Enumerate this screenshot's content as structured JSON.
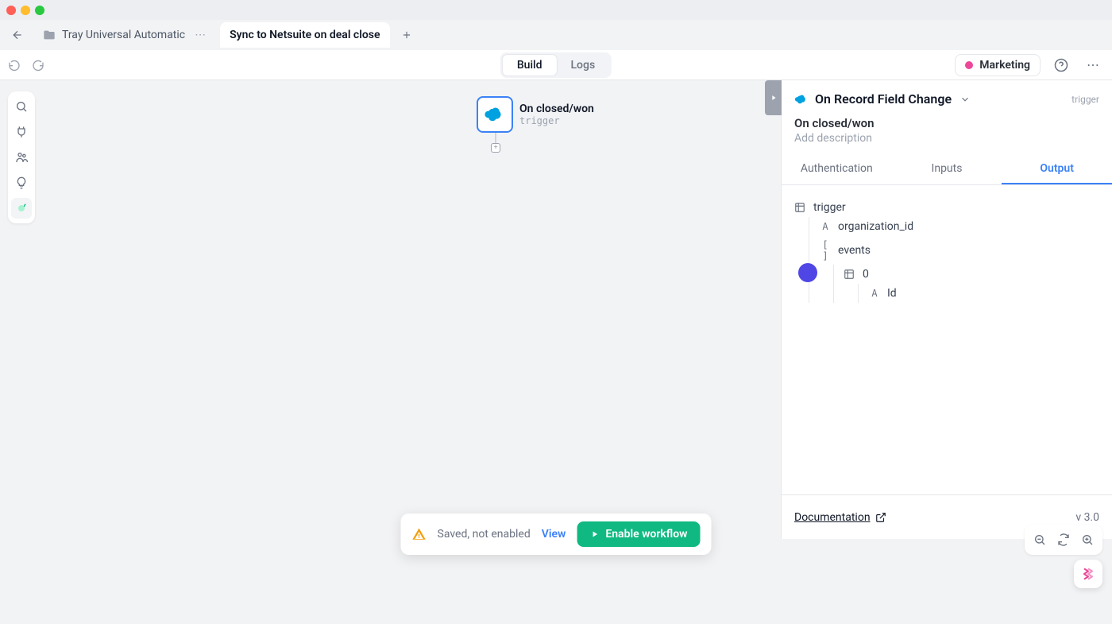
{
  "tabs": {
    "project": "Tray Universal Automatic",
    "active": "Sync to Netsuite on deal close"
  },
  "toolbar": {
    "segments": {
      "build": "Build",
      "logs": "Logs"
    },
    "marketing": "Marketing"
  },
  "canvas": {
    "node": {
      "title": "On closed/won",
      "sub": "trigger"
    }
  },
  "panel": {
    "heading": "On Record Field Change",
    "tag": "trigger",
    "title": "On closed/won",
    "desc": "Add description",
    "tabs": {
      "auth": "Authentication",
      "inputs": "Inputs",
      "output": "Output"
    },
    "tree": {
      "root": "trigger",
      "org": "organization_id",
      "events": "events",
      "zero": "0",
      "id": "Id"
    },
    "doc": "Documentation",
    "version": "v 3.0"
  },
  "status": {
    "msg": "Saved, not enabled",
    "view": "View",
    "enable": "Enable workflow"
  }
}
